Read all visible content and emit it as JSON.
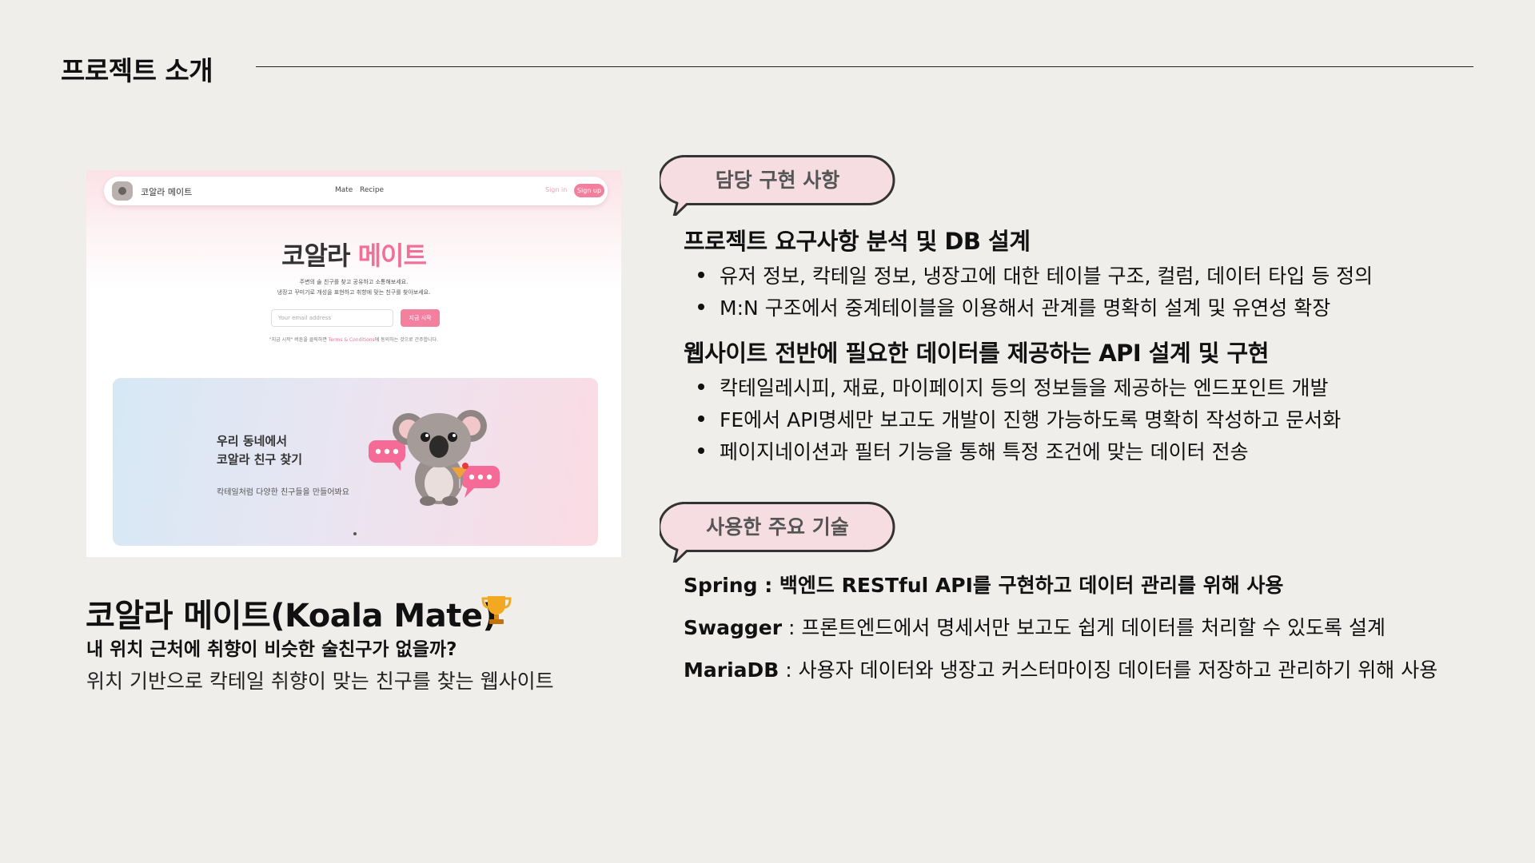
{
  "slide": {
    "title": "프로젝트 소개"
  },
  "screenshot": {
    "nav_brand": "코알라 메이트",
    "nav_mate": "Mate",
    "nav_recipe": "Recipe",
    "sign_in": "Sign in",
    "sign_up": "Sign up",
    "hero_title_1": "코알라",
    "hero_title_2": "메이트",
    "hero_sub_1": "주변의 술 친구를 찾고 공유하고 소통해보세요.",
    "hero_sub_2": "냉장고 꾸미기로 개성을 표현하고 취향에 맞는 친구를 찾아보세요.",
    "email_placeholder": "Your email address",
    "start_button": "지금 시작",
    "terms_pre": "\"지금 시작\" 버튼을 클릭하면",
    "terms_link": "Terms & Conditions",
    "terms_post": "에 동의하는 것으로 간주합니다.",
    "banner_line_1": "우리 동네에서",
    "banner_line_2": "코알라 친구 찾기",
    "banner_sub": "칵테일처럼 다양한 친구들을 만들어봐요"
  },
  "project": {
    "name": "코알라 메이트(Koala Mate)",
    "question": "내 위치 근처에 취향이 비슷한 술친구가 없을까?",
    "description": "위치 기반으로 칵테일 취향이 맞는 친구를 찾는 웹사이트"
  },
  "responsibilities": {
    "label": "담당 구현 사항",
    "sections": [
      {
        "heading": "프로젝트 요구사항 분석 및 DB 설계",
        "bullets": [
          "유저 정보, 칵테일 정보, 냉장고에 대한 테이블 구조, 컬럼, 데이터 타입 등 정의",
          "M:N 구조에서 중계테이블을 이용해서 관계를 명확히 설계 및 유연성 확장"
        ]
      },
      {
        "heading": "웹사이트 전반에 필요한 데이터를 제공하는 API 설계 및 구현",
        "bullets": [
          "칵테일레시피, 재료, 마이페이지 등의 정보들을 제공하는 엔드포인트 개발",
          "FE에서 API명세만 보고도 개발이 진행 가능하도록 명확히 작성하고 문서화",
          "페이지네이션과 필터 기능을 통해 특정 조건에 맞는 데이터 전송"
        ]
      }
    ]
  },
  "tech": {
    "label": "사용한 주요 기술",
    "items": [
      {
        "name": "Spring",
        "desc": " : 백엔드 RESTful API를 구현하고 데이터 관리를 위해 사용"
      },
      {
        "name": "Swagger",
        "desc": " : 프론트엔드에서 명세서만 보고도 쉽게 데이터를 처리할 수 있도록 설계"
      },
      {
        "name": "MariaDB",
        "desc": " : 사용자 데이터와 냉장고 커스터마이징 데이터를 저장하고 관리하기 위해 사용"
      }
    ]
  },
  "colors": {
    "background": "#efeeeb",
    "bubble_fill": "#f6dde1",
    "bubble_stroke": "#333333",
    "accent_pink": "#f0709a",
    "trophy": "#f2a820"
  }
}
